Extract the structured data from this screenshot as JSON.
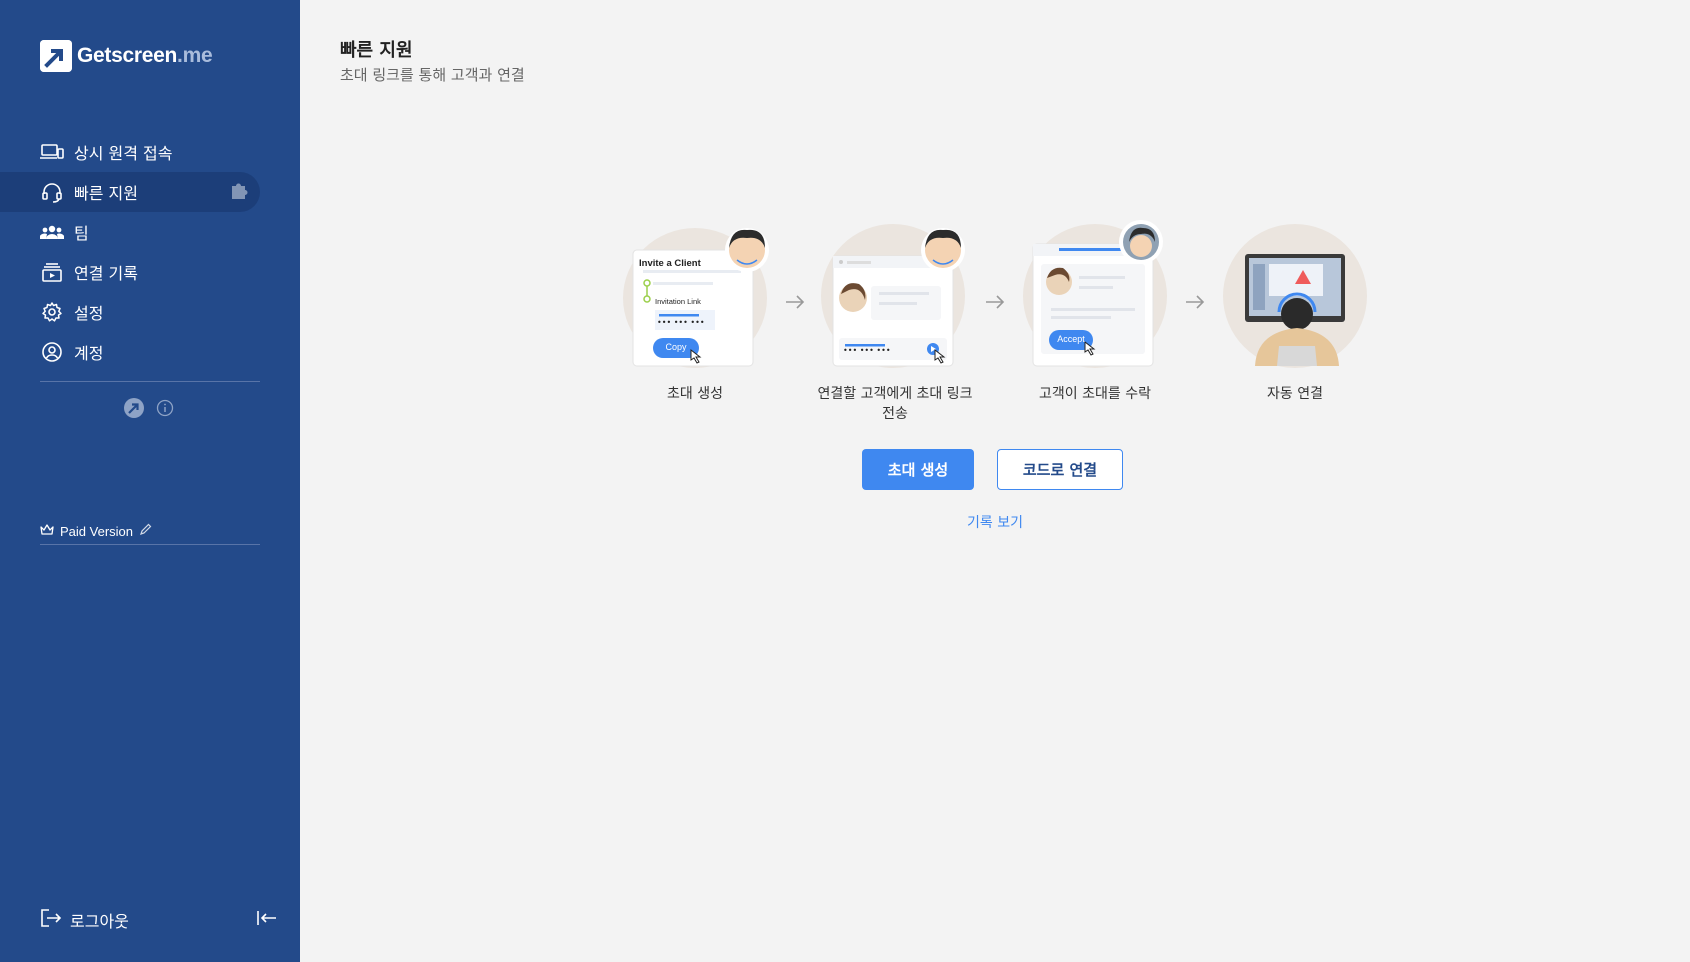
{
  "app": {
    "logo_text_main": "Getscreen",
    "logo_text_suffix": ".me"
  },
  "sidebar": {
    "items": [
      {
        "label": "상시 원격 접속",
        "icon": "devices-icon"
      },
      {
        "label": "빠른 지원",
        "icon": "headset-icon",
        "active": true
      },
      {
        "label": "팀",
        "icon": "team-icon"
      },
      {
        "label": "연결 기록",
        "icon": "history-icon"
      },
      {
        "label": "설정",
        "icon": "gear-icon"
      },
      {
        "label": "계정",
        "icon": "account-icon"
      }
    ],
    "paid_label": "Paid Version",
    "logout_label": "로그아웃"
  },
  "main": {
    "title": "빠른 지원",
    "subtitle": "초대 링크를 통해 고객과 연결",
    "steps": [
      {
        "label": "초대 생성",
        "card_title": "Invite a Client",
        "card_link_label": "Invitation Link",
        "card_dots": "••• ••• •••",
        "card_button": "Copy"
      },
      {
        "label": "연결할 고객에게 초대 링크 전송",
        "card_dots": "••• ••• •••"
      },
      {
        "label": "고객이 초대를 수락",
        "card_button": "Accept"
      },
      {
        "label": "자동 연결"
      }
    ],
    "primary_button": "초대 생성",
    "secondary_button": "코드로 연결",
    "history_link": "기록 보기"
  },
  "colors": {
    "sidebar_bg": "#234a8a",
    "accent": "#3f88f0",
    "main_bg": "#f3f3f3"
  }
}
